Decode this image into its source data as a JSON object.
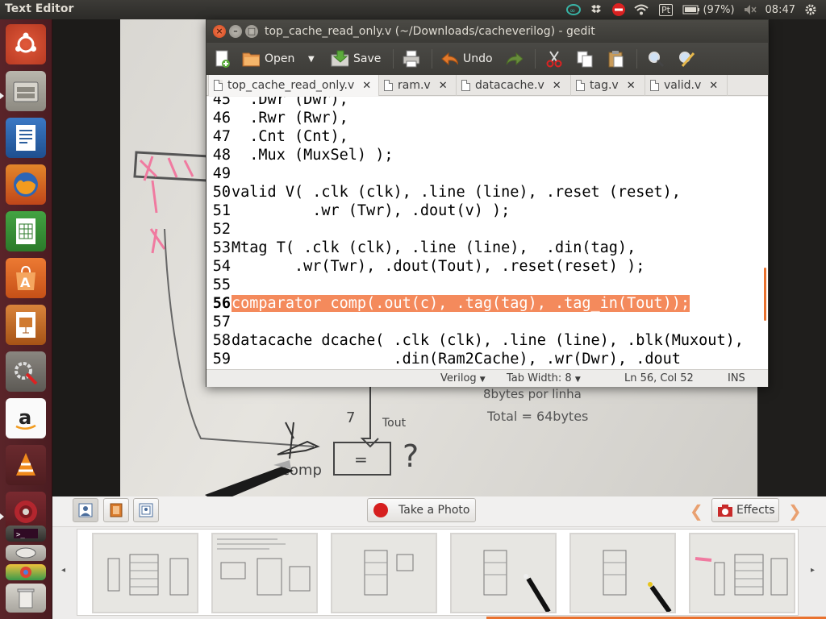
{
  "panel": {
    "app_title": "Text Editor",
    "battery": "(97%)",
    "time": "08:47",
    "tray_icons": [
      "arduino-icon",
      "dropbox-icon",
      "do-not-disturb-icon",
      "wifi-icon",
      "keyboard-pt-icon",
      "battery-icon",
      "volume-muted-icon"
    ],
    "keyboard_layout": "Pt"
  },
  "launcher": {
    "items": [
      "ubuntu-dash-icon",
      "files-icon",
      "writer-icon",
      "firefox-icon",
      "calc-icon",
      "software-center-icon",
      "impress-icon",
      "system-settings-icon",
      "amazon-icon",
      "vlc-icon",
      "cheese-icon",
      "terminal-icon",
      "chrome-icon",
      "disk-icon"
    ]
  },
  "gedit": {
    "title": "top_cache_read_only.v (~/Downloads/cacheverilog) - gedit",
    "toolbar": {
      "open": "Open",
      "save": "Save",
      "undo": "Undo"
    },
    "tabs": [
      {
        "label": "top_cache_read_only.v"
      },
      {
        "label": "ram.v"
      },
      {
        "label": "datacache.v"
      },
      {
        "label": "tag.v"
      },
      {
        "label": "valid.v"
      }
    ],
    "lines": [
      {
        "num": "45",
        "text": "  .Dwr (Dwr),"
      },
      {
        "num": "46",
        "text": "  .Rwr (Rwr),"
      },
      {
        "num": "47",
        "text": "  .Cnt (Cnt),"
      },
      {
        "num": "48",
        "text": "  .Mux (MuxSel) );"
      },
      {
        "num": "49",
        "text": ""
      },
      {
        "num": "50",
        "text": "valid V( .clk (clk), .line (line), .reset (reset),"
      },
      {
        "num": "51",
        "text": "         .wr (Twr), .dout(v) );"
      },
      {
        "num": "52",
        "text": ""
      },
      {
        "num": "53",
        "text": "Mtag T( .clk (clk), .line (line),  .din(tag),"
      },
      {
        "num": "54",
        "text": "       .wr(Twr), .dout(Tout), .reset(reset) );"
      },
      {
        "num": "55",
        "text": ""
      },
      {
        "num": "56",
        "text": "comparator comp(.out(c), .tag(tag), .tag_in(Tout));"
      },
      {
        "num": "57",
        "text": ""
      },
      {
        "num": "58",
        "text": "datacache dcache( .clk (clk), .line (line), .blk(Muxout),"
      },
      {
        "num": "59",
        "text": "                  .din(Ram2Cache), .wr(Dwr), .dout"
      }
    ],
    "status": {
      "language": "Verilog",
      "tab_width": "Tab Width: 8",
      "position": "Ln 56, Col 52",
      "mode": "INS"
    }
  },
  "cheese": {
    "take_photo": "Take a Photo",
    "effects": "Effects"
  },
  "colors": {
    "highlight": "#f48a5c",
    "accent": "#e9722f",
    "launcher": "#5a2429"
  }
}
